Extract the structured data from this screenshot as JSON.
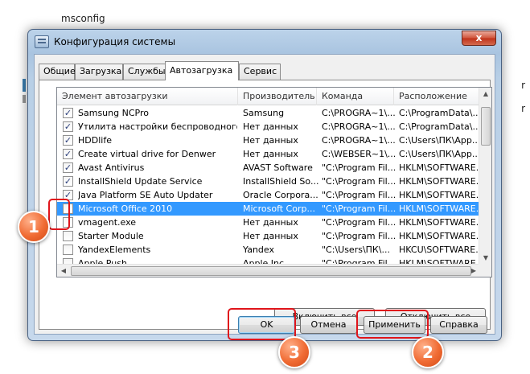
{
  "background": {
    "snippet": "msconfig",
    "right_glyph_1": "r",
    "right_glyph_2": "r"
  },
  "window": {
    "title": "Конфигурация системы",
    "close_label": "x",
    "tabs": [
      {
        "label": "Общие"
      },
      {
        "label": "Загрузка"
      },
      {
        "label": "Службы"
      },
      {
        "label": "Автозагрузка",
        "active": true
      },
      {
        "label": "Сервис"
      }
    ]
  },
  "startup_list": {
    "columns": [
      "Элемент автозагрузки",
      "Производитель",
      "Команда",
      "Расположение"
    ],
    "rows": [
      {
        "checked": true,
        "name": "Samsung NCPro",
        "maker": "Samsung",
        "command": "C:\\PROGRA~1\\...",
        "location": "C:\\ProgramData\\..."
      },
      {
        "checked": true,
        "name": "Утилита настройки беспроводного с...",
        "maker": "Нет данных",
        "command": "C:\\PROGRA~1\\...",
        "location": "C:\\ProgramData\\..."
      },
      {
        "checked": true,
        "name": "HDDlife",
        "maker": "Нет данных",
        "command": "C:\\PROGRA~1\\...",
        "location": "C:\\Users\\ПК\\App..."
      },
      {
        "checked": true,
        "name": "Create virtual drive for Denwer",
        "maker": "Нет данных",
        "command": "C:\\WEBSER~1\\...",
        "location": "C:\\Users\\ПК\\App..."
      },
      {
        "checked": true,
        "name": "Avast Antivirus",
        "maker": "AVAST Software",
        "command": "\"C:\\Program Fil...",
        "location": "HKLM\\SOFTWARE..."
      },
      {
        "checked": true,
        "name": "InstallShield Update Service",
        "maker": "InstallShield So...",
        "command": "\"C:\\Program Fil...",
        "location": "HKLM\\SOFTWARE..."
      },
      {
        "checked": true,
        "name": "Java Platform SE Auto Updater",
        "maker": "Oracle Corpora...",
        "command": "\"C:\\Program Fil...",
        "location": "HKLM\\SOFTWARE..."
      },
      {
        "checked": false,
        "name": "Microsoft Office 2010",
        "maker": "Microsoft Corp...",
        "command": "\"C:\\Program Fil...",
        "location": "HKLM\\SOFTWARE...",
        "selected": true
      },
      {
        "checked": false,
        "name": "vmagent.exe",
        "maker": "Нет данных",
        "command": "\"C:\\Program Fil...",
        "location": "HKLM\\SOFTWARE..."
      },
      {
        "checked": false,
        "name": "Starter Module",
        "maker": "Нет данных",
        "command": "\"C:\\Program Fil...",
        "location": "HKLM\\SOFTWARE..."
      },
      {
        "checked": false,
        "name": "YandexElements",
        "maker": "Yandex",
        "command": "\"C:\\Users\\ПК\\...",
        "location": "HKCU\\SOFTWARE..."
      },
      {
        "checked": false,
        "name": "Apple Push",
        "maker": "Apple Inc.",
        "command": "\"C:\\Program Fil...",
        "location": "HKLM\\SOFTWARE..."
      }
    ]
  },
  "buttons": {
    "enable_all": "Включить все",
    "disable_all": "Отключить все",
    "ok": "OK",
    "cancel": "Отмена",
    "apply": "Применить",
    "help": "Справка"
  },
  "annotations": {
    "step1": "1",
    "step2": "2",
    "step3": "3",
    "color": "#e0151b"
  }
}
